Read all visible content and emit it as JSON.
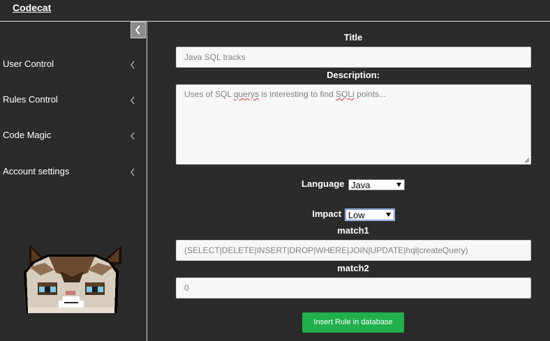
{
  "app": {
    "brand": "Codecat"
  },
  "sidebar": {
    "items": [
      {
        "label": "User Control"
      },
      {
        "label": "Rules Control"
      },
      {
        "label": "Code Magic"
      },
      {
        "label": "Account settings"
      }
    ],
    "collapse_icon": "chevron-left-icon"
  },
  "form": {
    "title_label": "Title",
    "title_value": "Java SQL tracks",
    "description_label": "Description:",
    "description_value_parts": [
      "Uses of SQL ",
      "querys",
      " is interesting to find ",
      "SQLi",
      " points..."
    ],
    "language_label": "Language",
    "language_selected": "Java",
    "impact_label": "Impact",
    "impact_selected": "Low",
    "match1_label": "match1",
    "match1_value": "(SELECT|DELETE|INSERT|DROP|WHERE|JOIN|UPDATE|hql|createQuery)",
    "match2_label": "match2",
    "match2_value": "0",
    "submit_label": "Insert Rule in database"
  },
  "colors": {
    "background": "#2b2b2b",
    "accent_button": "#21b04c"
  }
}
